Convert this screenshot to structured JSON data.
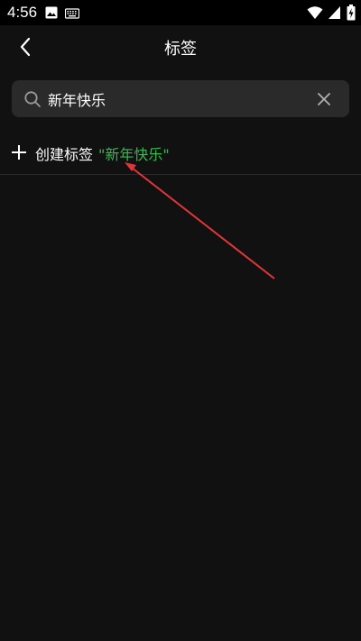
{
  "status_bar": {
    "time": "4:56",
    "icons": [
      "image-icon",
      "keyboard-icon",
      "wifi-icon",
      "signal-icon",
      "battery-charging-icon"
    ]
  },
  "header": {
    "title": "标签",
    "back_icon": "chevron-left-icon"
  },
  "search": {
    "value": "新年快乐",
    "placeholder": "",
    "clear_icon": "close-icon"
  },
  "create_tag": {
    "label": "创建标签",
    "name_quoted": "\"新年快乐\"",
    "icon": "plus-icon"
  },
  "annotation": {
    "type": "arrow",
    "color": "#e0363a"
  },
  "colors": {
    "background": "#111111",
    "search_background": "#2a2a2a",
    "accent_green": "#2fbf4a"
  }
}
